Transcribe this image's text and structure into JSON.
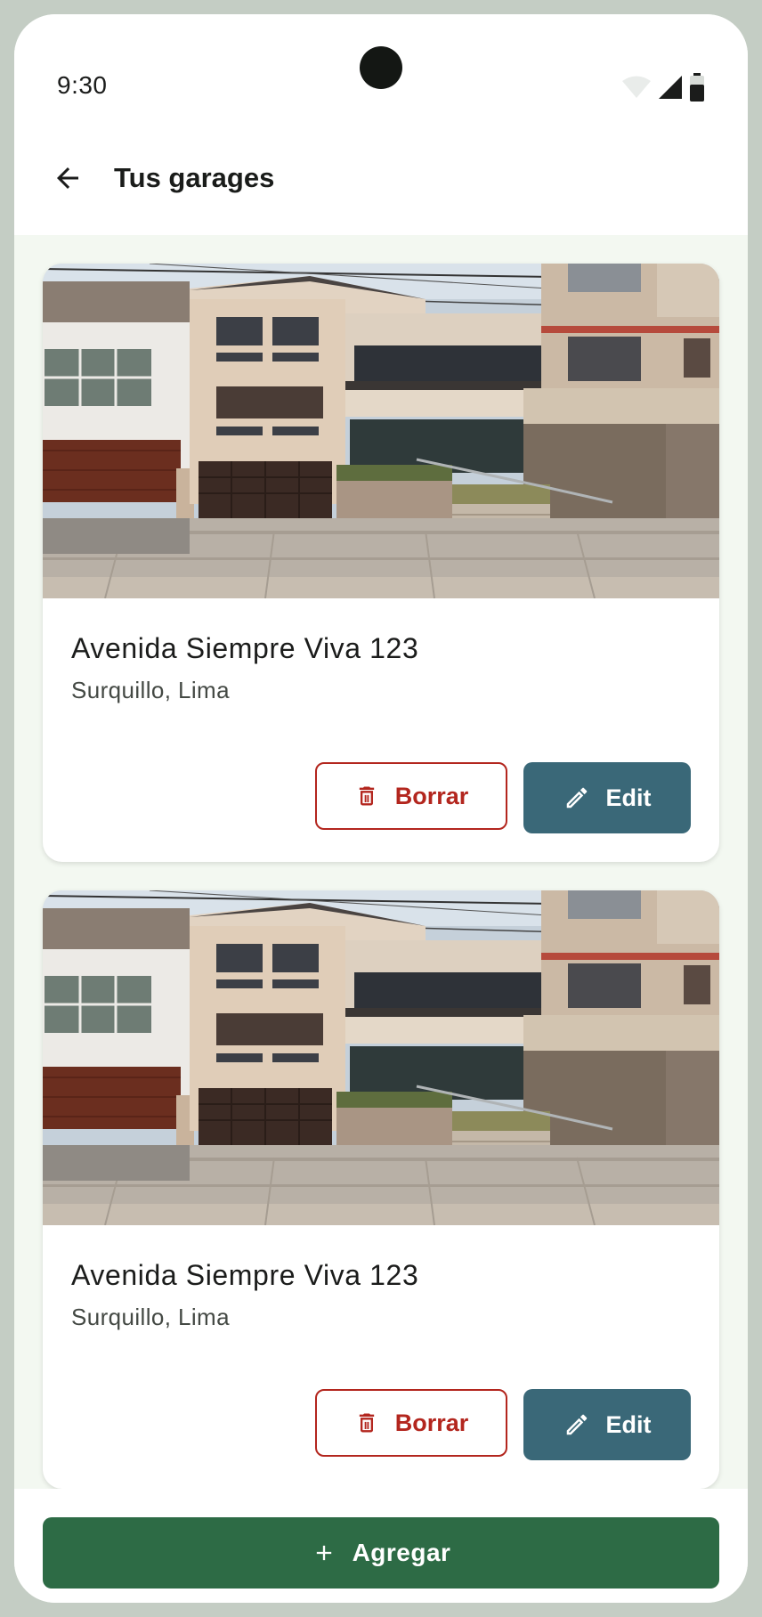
{
  "status_bar": {
    "time": "9:30",
    "icons": [
      "wifi-icon",
      "cellular-signal-icon",
      "battery-icon"
    ]
  },
  "app_bar": {
    "back_icon": "arrow-left-icon",
    "title": "Tus garages"
  },
  "garages": [
    {
      "address": "Avenida Siempre Viva 123",
      "district": "Surquillo, Lima",
      "delete_label": "Borrar",
      "delete_icon": "trash-icon",
      "edit_label": "Edit",
      "edit_icon": "pencil-icon"
    },
    {
      "address": "Avenida Siempre Viva 123",
      "district": "Surquillo, Lima",
      "delete_label": "Borrar",
      "delete_icon": "trash-icon",
      "edit_label": "Edit",
      "edit_icon": "pencil-icon"
    }
  ],
  "bottom_action": {
    "label": "Agregar",
    "icon": "plus-icon"
  },
  "colors": {
    "primary": "#2d6b45",
    "edit": "#3a6878",
    "danger": "#b3261e",
    "background": "#f3f8f1",
    "frame": "#c4cdc4"
  }
}
